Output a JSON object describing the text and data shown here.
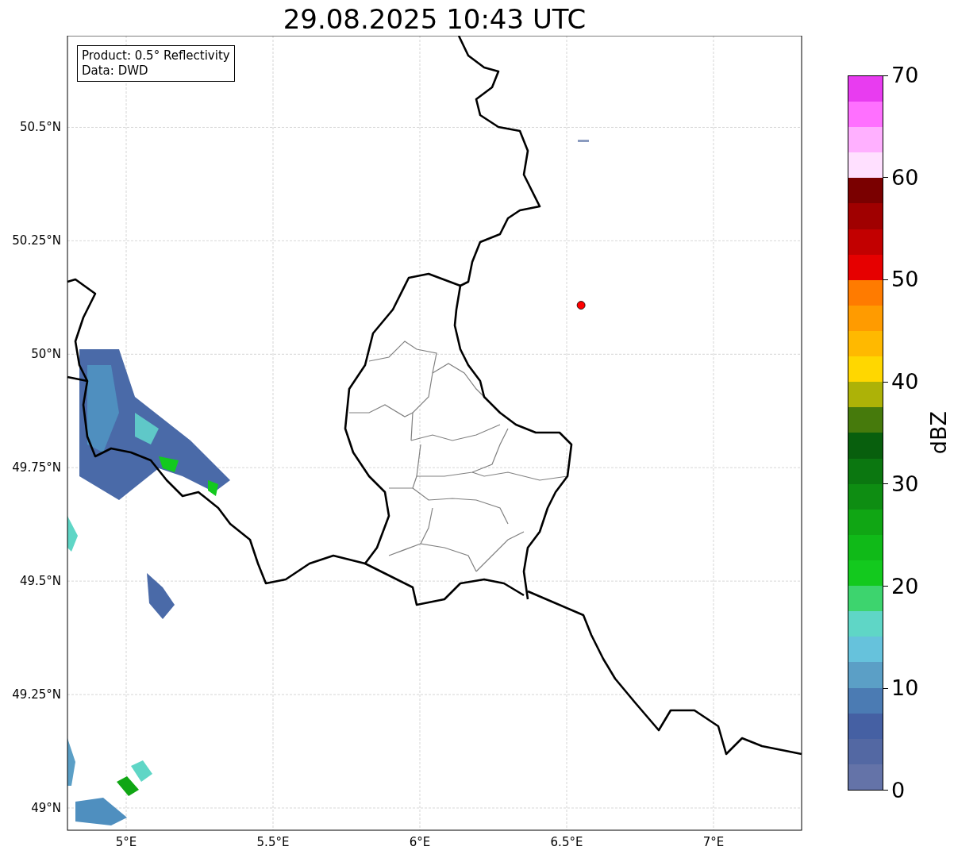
{
  "title": "29.08.2025 10:43 UTC",
  "map": {
    "latitude_labels": [
      "50.5°N",
      "50.25°N",
      "50°N",
      "49.75°N",
      "49.5°N",
      "49.25°N",
      "49°N"
    ],
    "longitude_labels": [
      "5°E",
      "5.5°E",
      "6°E",
      "6.5°E",
      "7°E"
    ],
    "info_box": {
      "lines": [
        "Product: 0.5° Reflectivity",
        "Data: DWD"
      ]
    }
  },
  "colorbar": {
    "label": "dBZ",
    "ticks": [
      "70",
      "60",
      "50",
      "40",
      "30",
      "20",
      "10",
      "0"
    ]
  }
}
